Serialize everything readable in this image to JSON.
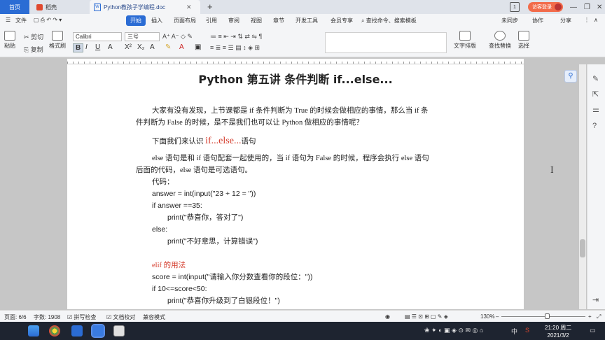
{
  "titlebar": {
    "tabs": [
      {
        "label": "首页"
      },
      {
        "label": "稻壳"
      },
      {
        "label": "Python教孩子学编程.doc"
      }
    ],
    "badge_count": "1",
    "visitor_label": "访客登录"
  },
  "menu": {
    "items": [
      "文件",
      "开始",
      "插入",
      "页面布局",
      "引用",
      "审阅",
      "视图",
      "章节",
      "开发工具",
      "会员专享"
    ],
    "search_label": "查找命令、搜索模板",
    "right_items": [
      "未同步",
      "协作",
      "分享"
    ]
  },
  "ribbon": {
    "paste_label": "粘贴",
    "cut_label": "剪切",
    "copy_label": "复制",
    "format_painter_label": "格式刷",
    "font_name": "Calibri",
    "font_size": "三号",
    "text_layout_label": "文字排版",
    "find_replace_label": "查找替换",
    "select_label": "选择"
  },
  "document": {
    "title": "Python 第五讲 条件判断 if...else...",
    "para1_line1": "大家有没有发现，上节课都是 if 条件判断为 True 的时候会做相应的事情，那么当 if 条",
    "para1_line2": "件判断为 False 的时候，是不是我们也可以让 Python 做相应的事情呢？",
    "para2_prefix": "下面我们来认识 ",
    "para2_keyword": "if...else...",
    "para2_suffix": "语句",
    "para3_line1": "else 语句是和 if 语句配套一起使用的，当 if 语句为 False 的时候，程序会执行 else 语句",
    "para3_line2": "后面的代码，else 语句是可选语句。",
    "code_label": "代码：",
    "code1": "answer = int(input(\"23 + 12 =     \"))",
    "code2": "if answer ==35:",
    "code3": "print(\"恭喜你，答对了\")",
    "code4": "else:",
    "code5": "print(\"不好意思，计算错误\")",
    "elif_heading": "elif 的用法",
    "code6": "score = int(input(\"请输入你分数查看你的段位：\"))",
    "code7": "if 10<=score<50:",
    "code8": "print(\"恭喜你升级到了白银段位！\")"
  },
  "status": {
    "page": "页面: 6/6",
    "words": "字数: 1908",
    "spellcheck": "拼写检查",
    "proofread": "文档校对",
    "compat": "兼容模式",
    "zoom": "130%"
  },
  "taskbar": {
    "time": "21:20 周二",
    "date": "2021/3/2",
    "ime": "中"
  },
  "colors": {
    "accent": "#2b6cd4",
    "highlight_red": "#d43a2a",
    "visitor_button": "#f26b4a"
  }
}
